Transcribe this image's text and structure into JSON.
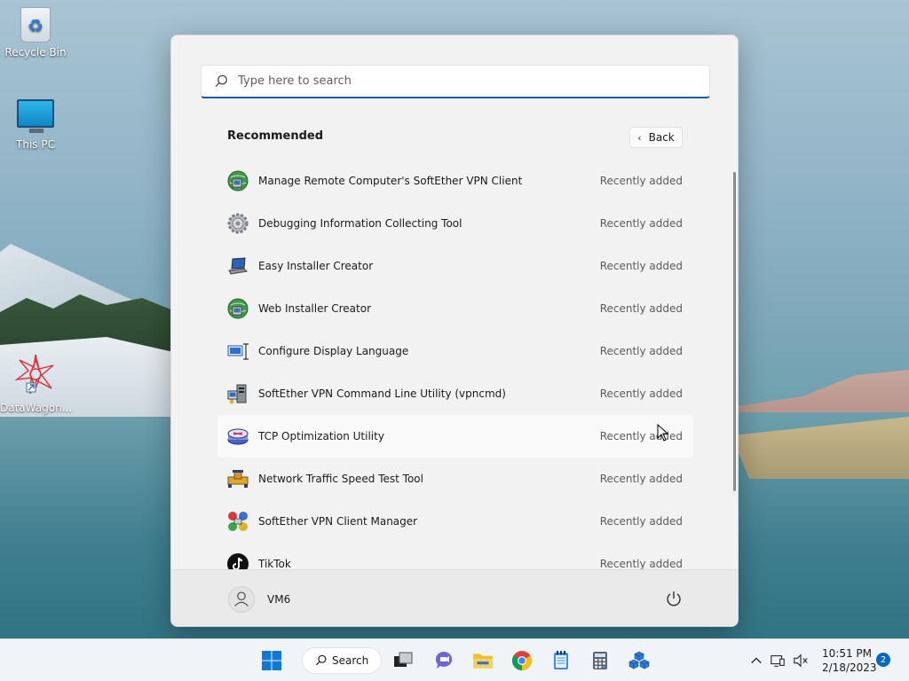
{
  "desktop": {
    "icons": [
      {
        "label": "Recycle Bin"
      },
      {
        "label": "This PC"
      },
      {
        "label": "DataWagon..."
      }
    ]
  },
  "start_menu": {
    "search_placeholder": "Type here to search",
    "section_title": "Recommended",
    "back_label": "Back",
    "items": [
      {
        "name": "Manage Remote Computer's SoftEther VPN Client",
        "meta": "Recently added",
        "icon": "globe-computer-icon"
      },
      {
        "name": "Debugging Information Collecting Tool",
        "meta": "Recently added",
        "icon": "gear-icon"
      },
      {
        "name": "Easy Installer Creator",
        "meta": "Recently added",
        "icon": "laptop-icon"
      },
      {
        "name": "Web Installer Creator",
        "meta": "Recently added",
        "icon": "globe-computer-icon"
      },
      {
        "name": "Configure Display Language",
        "meta": "Recently added",
        "icon": "display-language-icon"
      },
      {
        "name": "SoftEther VPN Command Line Utility (vpncmd)",
        "meta": "Recently added",
        "icon": "server-icon"
      },
      {
        "name": "TCP Optimization Utility",
        "meta": "Recently added",
        "icon": "router-icon"
      },
      {
        "name": "Network Traffic Speed Test Tool",
        "meta": "Recently added",
        "icon": "pipe-icon"
      },
      {
        "name": "SoftEther VPN Client Manager",
        "meta": "Recently added",
        "icon": "vpn-client-icon"
      },
      {
        "name": "TikTok",
        "meta": "Recently added",
        "icon": "tiktok-icon"
      }
    ],
    "user": {
      "name": "VM6"
    }
  },
  "taskbar": {
    "search_label": "Search",
    "time": "10:51 PM",
    "date": "2/18/2023",
    "notification_count": "2"
  },
  "colors": {
    "accent": "#005fb8",
    "badge": "#0067c0"
  }
}
